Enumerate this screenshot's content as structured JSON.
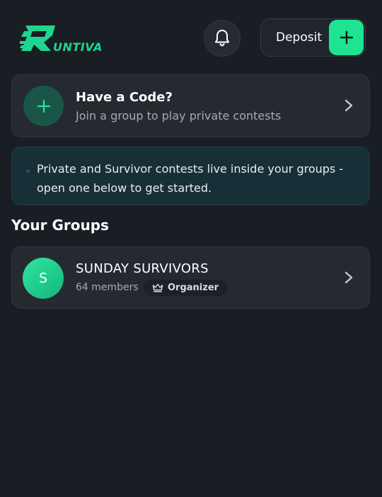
{
  "header": {
    "logo_text": "UNTIVA",
    "deposit_label": "Deposit"
  },
  "icons": {
    "bell": "bell-icon",
    "plus": "plus-icon",
    "chevron": "chevron-right-icon",
    "crown": "crown-icon"
  },
  "code_card": {
    "title": "Have a Code?",
    "subtitle": "Join a group to play private contests"
  },
  "info_banner": {
    "text": "Private and Survivor contests live inside your groups - open one below to get started."
  },
  "groups_section": {
    "title": "Your Groups",
    "items": [
      {
        "initial": "S",
        "name": "SUNDAY SURVIVORS",
        "members": "64 members",
        "role": "Organizer"
      }
    ]
  },
  "colors": {
    "background": "#191d24",
    "card": "#252a31",
    "accent": "#1ee391",
    "banner": "#173038"
  }
}
